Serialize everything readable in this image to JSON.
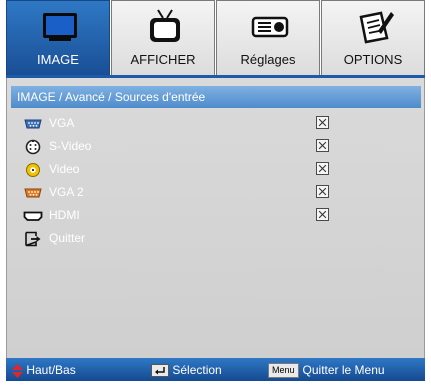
{
  "tabs": [
    {
      "label": "IMAGE",
      "icon": "monitor-icon",
      "active": true
    },
    {
      "label": "AFFICHER",
      "icon": "tv-icon",
      "active": false
    },
    {
      "label": "Réglages",
      "icon": "projector-icon",
      "active": false
    },
    {
      "label": "OPTIONS",
      "icon": "notepad-pen-icon",
      "active": false
    }
  ],
  "breadcrumb": "IMAGE / Avancé / Sources d'entrée",
  "items": [
    {
      "label": "VGA",
      "icon": "vga-port-icon",
      "checked": true
    },
    {
      "label": "S-Video",
      "icon": "svideo-port-icon",
      "checked": true
    },
    {
      "label": "Video",
      "icon": "video-port-icon",
      "checked": true
    },
    {
      "label": "VGA 2",
      "icon": "vga-port-icon",
      "checked": true
    },
    {
      "label": "HDMI",
      "icon": "hdmi-port-icon",
      "checked": true
    },
    {
      "label": "Quitter",
      "icon": "exit-icon",
      "checked": null
    }
  ],
  "footer": {
    "nav_label": "Haut/Bas",
    "select_label": "Sélection",
    "menu_badge": "Menu",
    "exit_label": "Quitter le Menu"
  },
  "colors": {
    "accent": "#1d5aa8",
    "panel": "#d4d4d4",
    "breadcrumb": "#6aa2d8"
  }
}
